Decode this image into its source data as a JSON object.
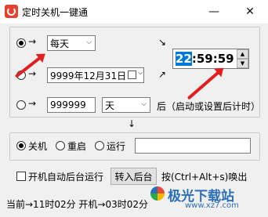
{
  "window": {
    "title": "定时关机一键通",
    "minimize": "—",
    "close": "✕"
  },
  "mode1": {
    "arrow": "→",
    "unit": "每天"
  },
  "mode2": {
    "arrow": "→",
    "date": "9999年12月31日"
  },
  "mode3": {
    "arrow": "→",
    "value": "999999",
    "unit": "天",
    "suffix": "后（启动或设置后计时）"
  },
  "diag_arrow_up": "↘",
  "diag_arrow_down": "↗",
  "time": {
    "hour": "22",
    "rest": ":59:59"
  },
  "down_arrow": "↓",
  "actions": {
    "shutdown": "关机",
    "restart": "重启",
    "run": "运行",
    "run_value": ""
  },
  "options": {
    "autostart": "开机自动后台运行",
    "to_background": "转入后台",
    "hotkey": "按(Ctrl+Alt+s)唤出"
  },
  "status": "当前→11时02分 开机→03时02分",
  "watermark": {
    "brand": "极光下载站",
    "url": "www.xz7.com"
  },
  "colors": {
    "annotation": "#e02020",
    "brand": "#2b6fb8"
  }
}
